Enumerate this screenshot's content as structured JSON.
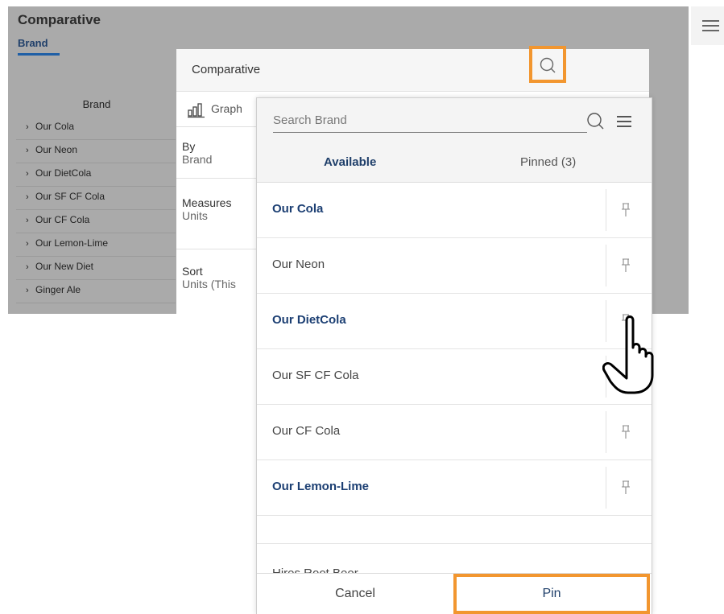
{
  "background": {
    "title": "Comparative",
    "tab": "Brand",
    "column_header": "Brand",
    "rows": [
      "Our Cola",
      "Our Neon",
      "Our DietCola",
      "Our SF CF Cola",
      "Our CF Cola",
      "Our Lemon-Lime",
      "Our New Diet",
      "Ginger Ale"
    ]
  },
  "dialog": {
    "title": "Comparative",
    "graph_tab": "Graph",
    "by_label": "By",
    "by_value": "Brand",
    "measures_label": "Measures",
    "measures_value": "Units",
    "sort_label": "Sort",
    "sort_value": "Units (This"
  },
  "search_panel": {
    "placeholder": "Search Brand",
    "tabs": {
      "available": "Available",
      "pinned": "Pinned (3)"
    },
    "items": [
      {
        "name": "Our Cola",
        "selected": true
      },
      {
        "name": "Our Neon",
        "selected": false
      },
      {
        "name": "Our DietCola",
        "selected": true
      },
      {
        "name": "Our SF CF Cola",
        "selected": false
      },
      {
        "name": "Our CF Cola",
        "selected": false
      },
      {
        "name": "Our Lemon-Lime",
        "selected": true
      }
    ],
    "cutoff_item": "Hires Root Beer",
    "cancel_label": "Cancel",
    "pin_label": "Pin"
  },
  "colors": {
    "highlight": "#f2962f",
    "selected_text": "#1c3f73",
    "overlay": "#aaaaaa"
  },
  "icons": [
    "search-icon",
    "menu-icon",
    "pin-icon",
    "graph-icon",
    "hand-cursor-icon",
    "chevron-right-icon"
  ]
}
